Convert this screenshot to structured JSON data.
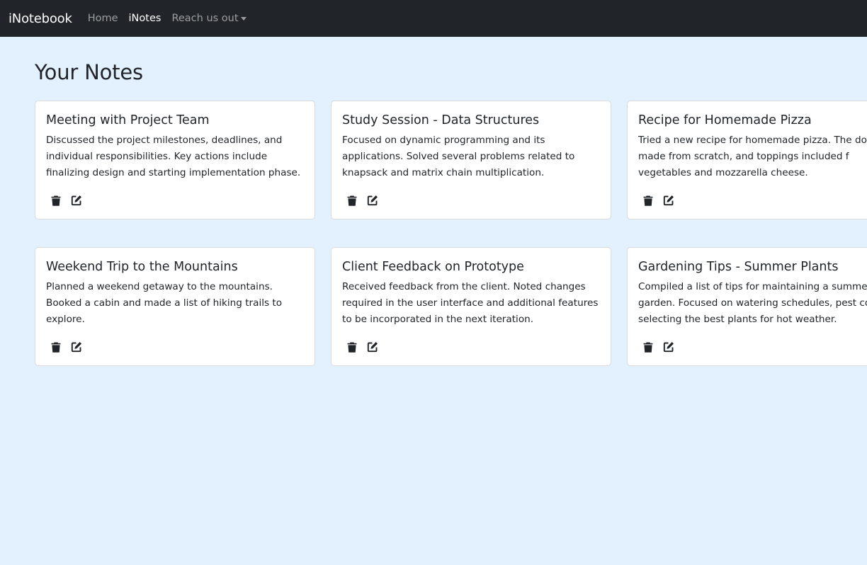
{
  "navbar": {
    "brand": "iNotebook",
    "links": [
      {
        "label": "Home",
        "active": false
      },
      {
        "label": "iNotes",
        "active": true
      },
      {
        "label": "Reach us out",
        "active": false,
        "dropdown": true
      }
    ]
  },
  "page": {
    "title": "Your Notes"
  },
  "icons": {
    "delete": "trash-icon",
    "edit": "edit-icon"
  },
  "notes": [
    {
      "title": "Meeting with Project Team",
      "description": "Discussed the project milestones, deadlines, and individual responsibilities. Key actions include finalizing design and starting implementation phase."
    },
    {
      "title": "Study Session - Data Structures",
      "description": "Focused on dynamic programming and its applications. Solved several problems related to knapsack and matrix chain multiplication."
    },
    {
      "title": "Recipe for Homemade Pizza",
      "description": "Tried a new recipe for homemade pizza. The dou was made from scratch, and toppings included f vegetables and mozzarella cheese."
    },
    {
      "title": "Weekend Trip to the Mountains",
      "description": "Planned a weekend getaway to the mountains. Booked a cabin and made a list of hiking trails to explore."
    },
    {
      "title": "Client Feedback on Prototype",
      "description": "Received feedback from the client. Noted changes required in the user interface and additional features to be incorporated in the next iteration."
    },
    {
      "title": "Gardening Tips - Summer Plants",
      "description": "Compiled a list of tips for maintaining a summer garden. Focused on watering schedules, pest cor and selecting the best plants for hot weather."
    }
  ]
}
